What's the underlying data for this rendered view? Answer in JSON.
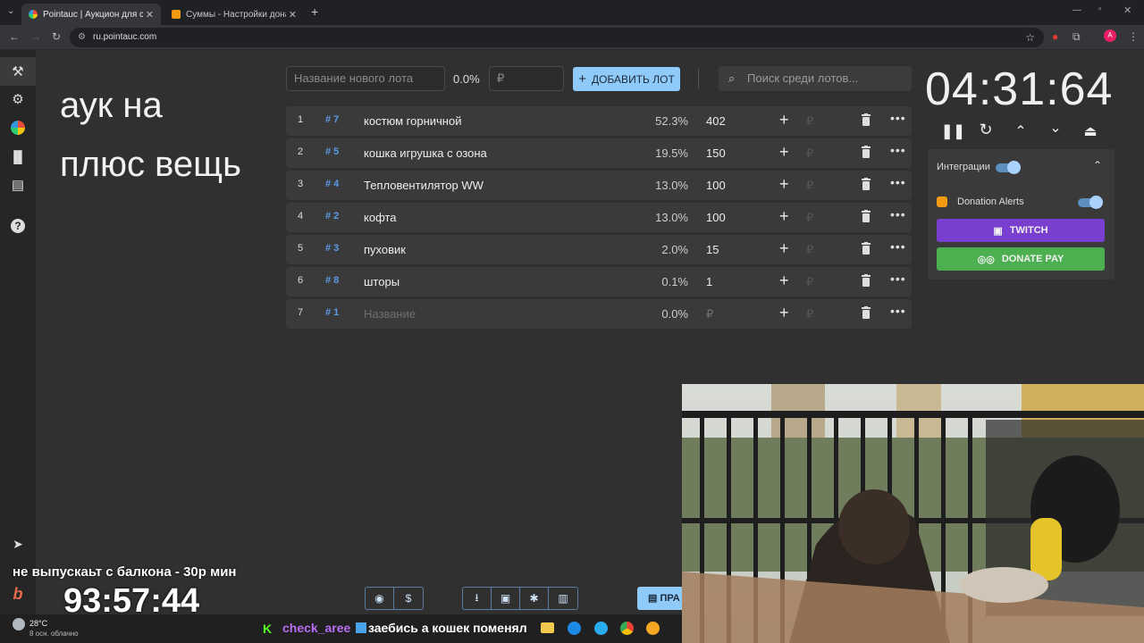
{
  "browser": {
    "tabs": [
      {
        "title": "Pointauc | Аукцион для стрим",
        "active": true
      },
      {
        "title": "Суммы - Настройки донатов",
        "active": false
      }
    ],
    "url": "ru.pointauc.com"
  },
  "overlay_note": {
    "line1": "аук на",
    "line2": "плюс вещь"
  },
  "toolbar": {
    "new_lot_placeholder": "Название нового лота",
    "percent": "0.0%",
    "amount_placeholder": "₽",
    "add_button": "ДОБАВИТЬ ЛОТ",
    "search_placeholder": "Поиск среди лотов..."
  },
  "lots": [
    {
      "num": "1",
      "id": "# 7",
      "name": "костюм горничной",
      "pct": "52.3%",
      "amount": "402"
    },
    {
      "num": "2",
      "id": "# 5",
      "name": "кошка игрушка с озона",
      "pct": "19.5%",
      "amount": "150"
    },
    {
      "num": "3",
      "id": "# 4",
      "name": "Тепловентилятор WW",
      "pct": "13.0%",
      "amount": "100"
    },
    {
      "num": "4",
      "id": "# 2",
      "name": "кофта",
      "pct": "13.0%",
      "amount": "100"
    },
    {
      "num": "5",
      "id": "# 3",
      "name": "пуховик",
      "pct": "2.0%",
      "amount": "15"
    },
    {
      "num": "6",
      "id": "# 8",
      "name": "шторы",
      "pct": "0.1%",
      "amount": "1"
    },
    {
      "num": "7",
      "id": "# 1",
      "name": "Название",
      "pct": "0.0%",
      "amount": "₽"
    }
  ],
  "currency_symbol": "₽",
  "timer": "04:31:64",
  "integrations": {
    "title": "Интеграции",
    "donation_alerts": "Donation Alerts",
    "twitch_button": "TWITCH",
    "donatepay_button": "DONATE PAY"
  },
  "bottom": {
    "partial_button": "ПРА"
  },
  "stream_overlay": {
    "text": "не выпускаьт с балкона - 30р мин",
    "timer": "93:57:44",
    "chat_user": "check_aree",
    "chat_msg": "заебись а кошек поменял"
  },
  "weather": {
    "temp": "28°C",
    "desc": "8 осн. облачно"
  },
  "colors": {
    "accent": "#90caf9",
    "twitch": "#7b3fd0",
    "donatepay": "#4caf50",
    "id_blue": "#5b9be6"
  }
}
